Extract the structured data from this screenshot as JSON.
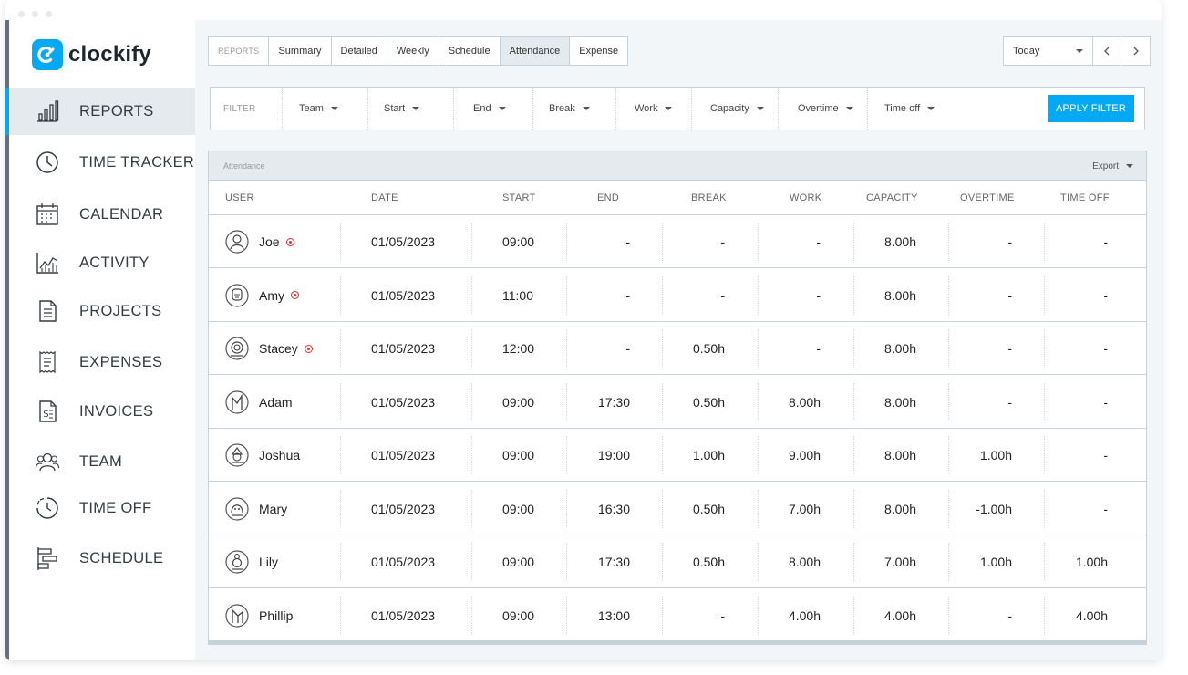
{
  "app": {
    "logo_text": "clockify",
    "brand_color": "#03a9f4"
  },
  "sidebar": {
    "items": [
      {
        "label": "REPORTS",
        "icon": "bar-chart-icon",
        "active": true
      },
      {
        "label": "TIME TRACKER",
        "icon": "clock-icon"
      },
      {
        "label": "CALENDAR",
        "icon": "calendar-icon"
      },
      {
        "label": "ACTIVITY",
        "icon": "activity-chart-icon"
      },
      {
        "label": "PROJECTS",
        "icon": "document-icon"
      },
      {
        "label": "EXPENSES",
        "icon": "receipt-icon"
      },
      {
        "label": "INVOICES",
        "icon": "invoice-icon"
      },
      {
        "label": "TEAM",
        "icon": "team-icon"
      },
      {
        "label": "TIME OFF",
        "icon": "time-off-icon"
      },
      {
        "label": "SCHEDULE",
        "icon": "schedule-icon"
      }
    ]
  },
  "tabs": {
    "label": "REPORTS",
    "items": [
      "Summary",
      "Detailed",
      "Weekly",
      "Schedule",
      "Attendance",
      "Expense"
    ],
    "active": "Attendance"
  },
  "date_range": {
    "value": "Today",
    "prev_icon": "chevron-left-icon",
    "next_icon": "chevron-right-icon"
  },
  "filter": {
    "label": "FILTER",
    "items": [
      "Team",
      "Start",
      "End",
      "Break",
      "Work",
      "Capacity",
      "Overtime",
      "Time off"
    ],
    "apply_label": "APPLY FILTER"
  },
  "table": {
    "title": "Attendance",
    "export_label": "Export",
    "columns": [
      "USER",
      "DATE",
      "START",
      "END",
      "BREAK",
      "WORK",
      "CAPACITY",
      "OVERTIME",
      "TIME OFF"
    ],
    "rows": [
      {
        "user": "Joe",
        "live": true,
        "avatar": "avatar-man-icon",
        "date": "01/05/2023",
        "start": "09:00",
        "end": "-",
        "break": "-",
        "work": "-",
        "capacity": "8.00h",
        "overtime": "-",
        "time_off": "-"
      },
      {
        "user": "Amy",
        "live": true,
        "avatar": "avatar-woman-icon",
        "date": "01/05/2023",
        "start": "11:00",
        "end": "-",
        "break": "-",
        "work": "-",
        "capacity": "8.00h",
        "overtime": "-",
        "time_off": "-"
      },
      {
        "user": "Stacey",
        "live": true,
        "avatar": "avatar-curly-icon",
        "date": "01/05/2023",
        "start": "12:00",
        "end": "-",
        "break": "0.50h",
        "work": "-",
        "capacity": "8.00h",
        "overtime": "-",
        "time_off": "-"
      },
      {
        "user": "Adam",
        "live": false,
        "avatar": "avatar-hair-icon",
        "date": "01/05/2023",
        "start": "09:00",
        "end": "17:30",
        "break": "0.50h",
        "work": "8.00h",
        "capacity": "8.00h",
        "overtime": "-",
        "time_off": "-"
      },
      {
        "user": "Joshua",
        "live": false,
        "avatar": "avatar-spiky-icon",
        "date": "01/05/2023",
        "start": "09:00",
        "end": "19:00",
        "break": "1.00h",
        "work": "9.00h",
        "capacity": "8.00h",
        "overtime": "1.00h",
        "time_off": "-"
      },
      {
        "user": "Mary",
        "live": false,
        "avatar": "avatar-bob-icon",
        "date": "01/05/2023",
        "start": "09:00",
        "end": "16:30",
        "break": "0.50h",
        "work": "7.00h",
        "capacity": "8.00h",
        "overtime": "-1.00h",
        "time_off": "-"
      },
      {
        "user": "Lily",
        "live": false,
        "avatar": "avatar-bun-icon",
        "date": "01/05/2023",
        "start": "09:00",
        "end": "17:30",
        "break": "0.50h",
        "work": "8.00h",
        "capacity": "7.00h",
        "overtime": "1.00h",
        "time_off": "1.00h"
      },
      {
        "user": "Phillip",
        "live": false,
        "avatar": "avatar-beard-icon",
        "date": "01/05/2023",
        "start": "09:00",
        "end": "13:00",
        "break": "-",
        "work": "4.00h",
        "capacity": "4.00h",
        "overtime": "-",
        "time_off": "4.00h"
      }
    ]
  }
}
